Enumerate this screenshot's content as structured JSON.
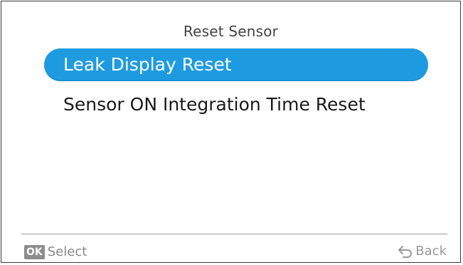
{
  "screen": {
    "title": "Reset Sensor"
  },
  "menu": {
    "items": [
      {
        "label": "Leak Display Reset",
        "selected": true
      },
      {
        "label": "Sensor ON Integration Time Reset",
        "selected": false
      }
    ]
  },
  "footer": {
    "ok_key": "OK",
    "ok_label": "Select",
    "back_icon": "back-arrow-icon",
    "back_label": "Back"
  },
  "colors": {
    "selection": "#1e9be0",
    "text": "#1a1a1a",
    "muted": "#999999"
  }
}
